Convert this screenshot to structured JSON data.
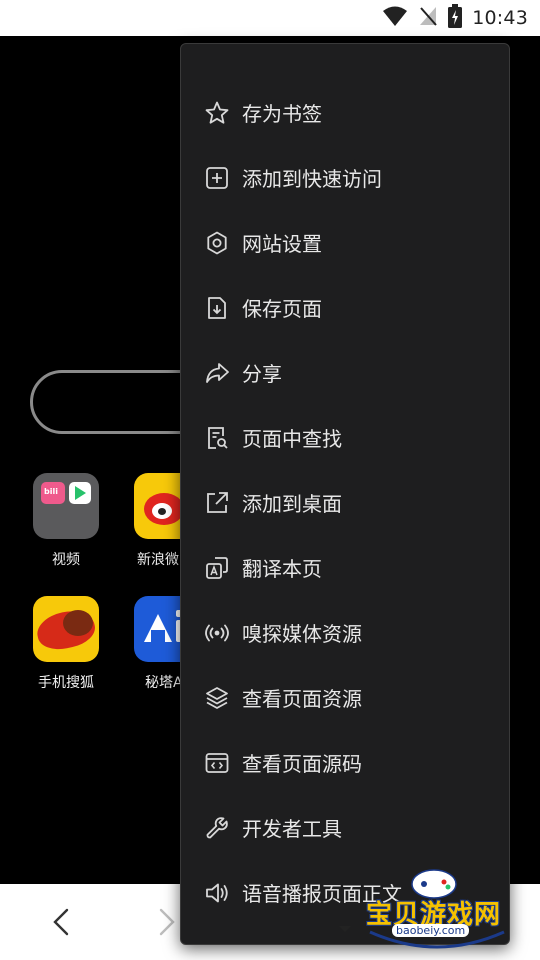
{
  "status_bar": {
    "time": "10:43"
  },
  "apps": [
    {
      "name": "video-folder",
      "label": "视频"
    },
    {
      "name": "weibo",
      "label": "新浪微"
    },
    {
      "name": "sohu-browser",
      "label": "手机搜狐"
    },
    {
      "name": "mita",
      "label": "秘塔A"
    }
  ],
  "menu": {
    "items": [
      {
        "id": "bookmark",
        "label": "存为书签",
        "icon": "star-icon"
      },
      {
        "id": "quick-access",
        "label": "添加到快速访问",
        "icon": "plus-square-icon"
      },
      {
        "id": "site-settings",
        "label": "网站设置",
        "icon": "gear-icon"
      },
      {
        "id": "save-page",
        "label": "保存页面",
        "icon": "download-file-icon"
      },
      {
        "id": "share",
        "label": "分享",
        "icon": "share-arrow-icon"
      },
      {
        "id": "find-in-page",
        "label": "页面中查找",
        "icon": "find-document-icon"
      },
      {
        "id": "add-to-desktop",
        "label": "添加到桌面",
        "icon": "external-box-icon"
      },
      {
        "id": "translate",
        "label": "翻译本页",
        "icon": "translate-icon"
      },
      {
        "id": "sniff-media",
        "label": "嗅探媒体资源",
        "icon": "broadcast-icon"
      },
      {
        "id": "page-resources",
        "label": "查看页面资源",
        "icon": "layers-icon"
      },
      {
        "id": "page-source",
        "label": "查看页面源码",
        "icon": "code-window-icon"
      },
      {
        "id": "dev-tools",
        "label": "开发者工具",
        "icon": "wrench-icon"
      },
      {
        "id": "read-aloud",
        "label": "语音播报页面正文",
        "icon": "speaker-icon"
      }
    ]
  },
  "watermark": {
    "text": "宝贝游戏网",
    "url": "baobeiy.com"
  }
}
